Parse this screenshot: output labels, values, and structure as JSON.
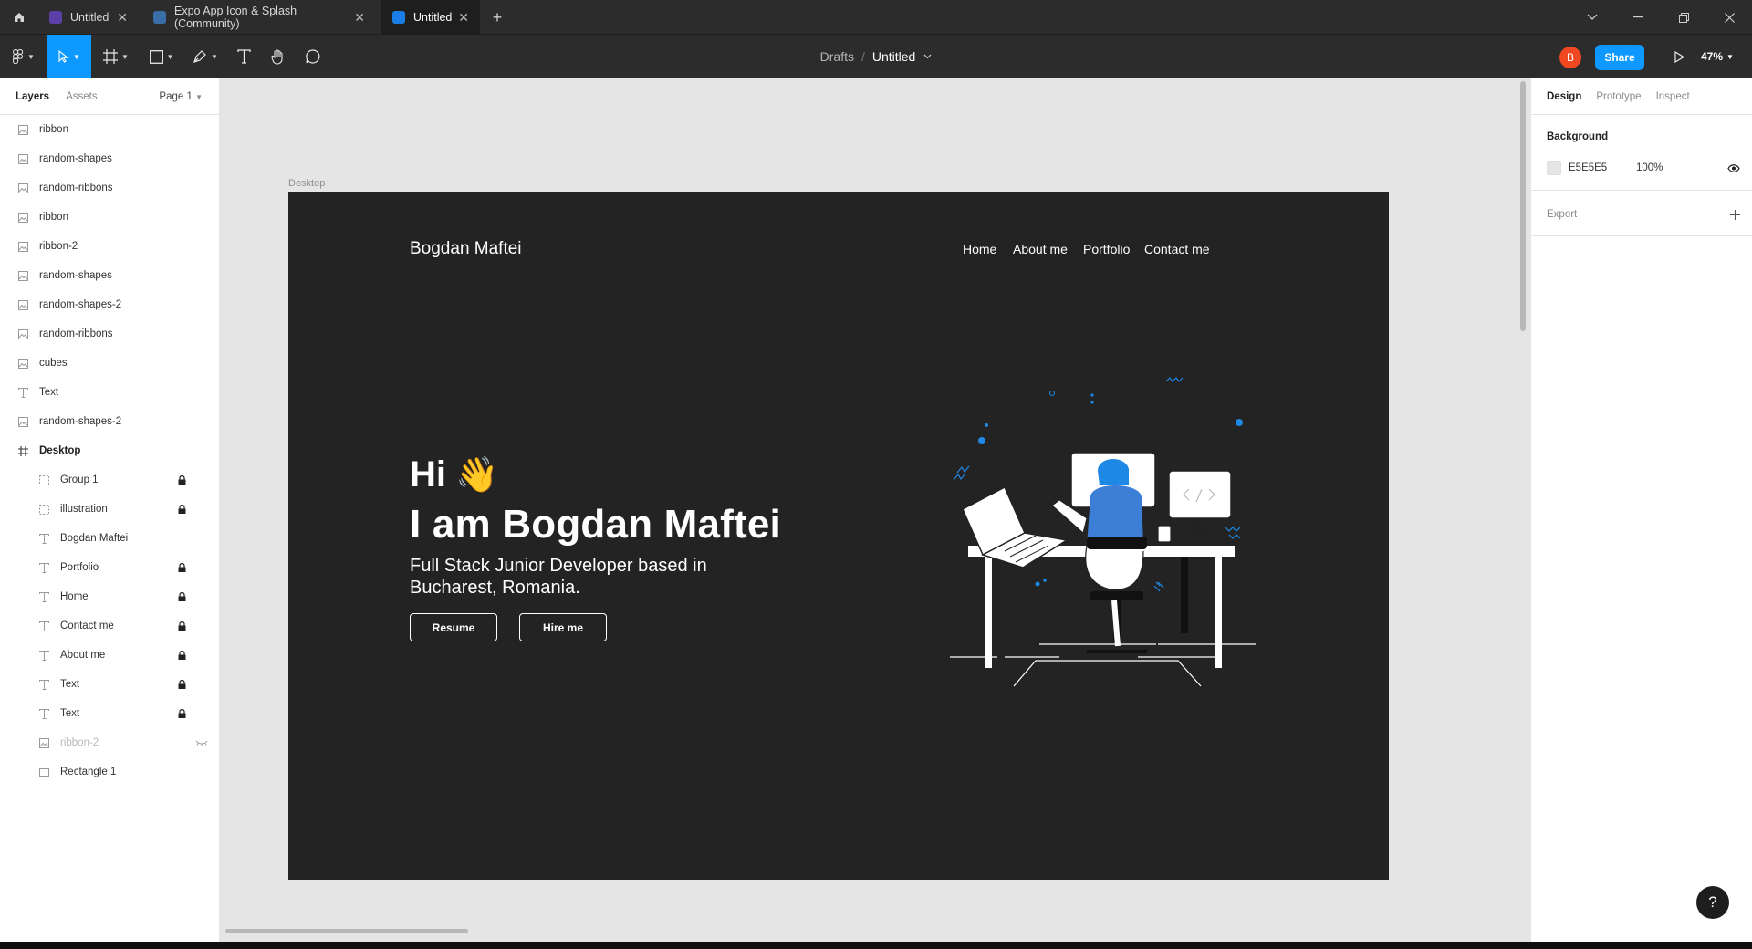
{
  "tabs": [
    {
      "label": "Untitled",
      "icon": "figma-file-icon",
      "color": "#5b3fa6"
    },
    {
      "label": "Expo App Icon & Splash (Community)",
      "icon": "community-file-icon",
      "color": "#3a6ea8"
    },
    {
      "label": "Untitled",
      "icon": "figma-file-icon",
      "color": "#1a7ee6"
    }
  ],
  "toolbar": {
    "breadcrumb_parent": "Drafts",
    "breadcrumb_sep": "/",
    "file_name": "Untitled",
    "avatar_initial": "B",
    "share_label": "Share",
    "zoom": "47%"
  },
  "left_panel": {
    "tab_layers": "Layers",
    "tab_assets": "Assets",
    "page": "Page 1"
  },
  "layers": [
    {
      "name": "ribbon",
      "icon": "image-icon",
      "indent": 0,
      "locked": false
    },
    {
      "name": "random-shapes",
      "icon": "image-icon",
      "indent": 0,
      "locked": false
    },
    {
      "name": "random-ribbons",
      "icon": "image-icon",
      "indent": 0,
      "locked": false
    },
    {
      "name": "ribbon",
      "icon": "image-icon",
      "indent": 0,
      "locked": false
    },
    {
      "name": "ribbon-2",
      "icon": "image-icon",
      "indent": 0,
      "locked": false
    },
    {
      "name": "random-shapes",
      "icon": "image-icon",
      "indent": 0,
      "locked": false
    },
    {
      "name": "random-shapes-2",
      "icon": "image-icon",
      "indent": 0,
      "locked": false
    },
    {
      "name": "random-ribbons",
      "icon": "image-icon",
      "indent": 0,
      "locked": false
    },
    {
      "name": "cubes",
      "icon": "image-icon",
      "indent": 0,
      "locked": false
    },
    {
      "name": "Text",
      "icon": "text-icon",
      "indent": 0,
      "locked": false
    },
    {
      "name": "random-shapes-2",
      "icon": "image-icon",
      "indent": 0,
      "locked": false
    },
    {
      "name": "Desktop",
      "icon": "frame-icon",
      "indent": 0,
      "locked": false,
      "bold": true
    },
    {
      "name": "Group 1",
      "icon": "group-icon",
      "indent": 1,
      "locked": true
    },
    {
      "name": "illustration",
      "icon": "group-icon",
      "indent": 1,
      "locked": true
    },
    {
      "name": "Bogdan Maftei",
      "icon": "text-icon",
      "indent": 1,
      "locked": false
    },
    {
      "name": "Portfolio",
      "icon": "text-icon",
      "indent": 1,
      "locked": true
    },
    {
      "name": "Home",
      "icon": "text-icon",
      "indent": 1,
      "locked": true
    },
    {
      "name": "Contact me",
      "icon": "text-icon",
      "indent": 1,
      "locked": true
    },
    {
      "name": "About me",
      "icon": "text-icon",
      "indent": 1,
      "locked": true
    },
    {
      "name": "Text",
      "icon": "text-icon",
      "indent": 1,
      "locked": true
    },
    {
      "name": "Text",
      "icon": "text-icon",
      "indent": 1,
      "locked": true
    },
    {
      "name": "ribbon-2",
      "icon": "image-icon",
      "indent": 1,
      "locked": false,
      "hidden": true
    },
    {
      "name": "Rectangle 1",
      "icon": "rectangle-icon",
      "indent": 1,
      "locked": false
    }
  ],
  "canvas": {
    "frame_label": "Desktop",
    "background": "#E5E5E5",
    "frame_fill": "#232323",
    "site": {
      "logo": "Bogdan Maftei",
      "nav": [
        "Home",
        "About me",
        "Portfolio",
        "Contact me"
      ],
      "hi": "Hi",
      "wave_emoji": "👋",
      "headline": "I am Bogdan Maftei",
      "subtitle": "Full Stack Junior Developer based in Bucharest, Romania.",
      "button_resume": "Resume",
      "button_hire": "Hire me",
      "accent": "#1e88e5"
    }
  },
  "right_panel": {
    "tab_design": "Design",
    "tab_prototype": "Prototype",
    "tab_inspect": "Inspect",
    "background_title": "Background",
    "bg_hex": "E5E5E5",
    "bg_opacity": "100%",
    "export_title": "Export"
  },
  "help_label": "?"
}
